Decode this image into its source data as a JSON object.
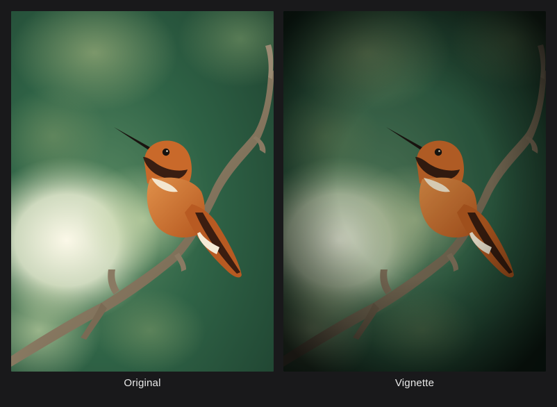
{
  "comparison": {
    "panels": [
      {
        "caption": "Original"
      },
      {
        "caption": "Vignette"
      }
    ]
  },
  "colors": {
    "background": "#19191b",
    "caption_text": "#e8e8e8",
    "bokeh_green_dark": "#1f4a33",
    "bokeh_green_mid": "#3f7a57",
    "bokeh_highlight": "#f4f1df",
    "bird_rufous": "#c96a2b",
    "bird_throat": "#3a1e12",
    "bird_belly": "#f3e6cf",
    "branch": "#8d7d68"
  }
}
